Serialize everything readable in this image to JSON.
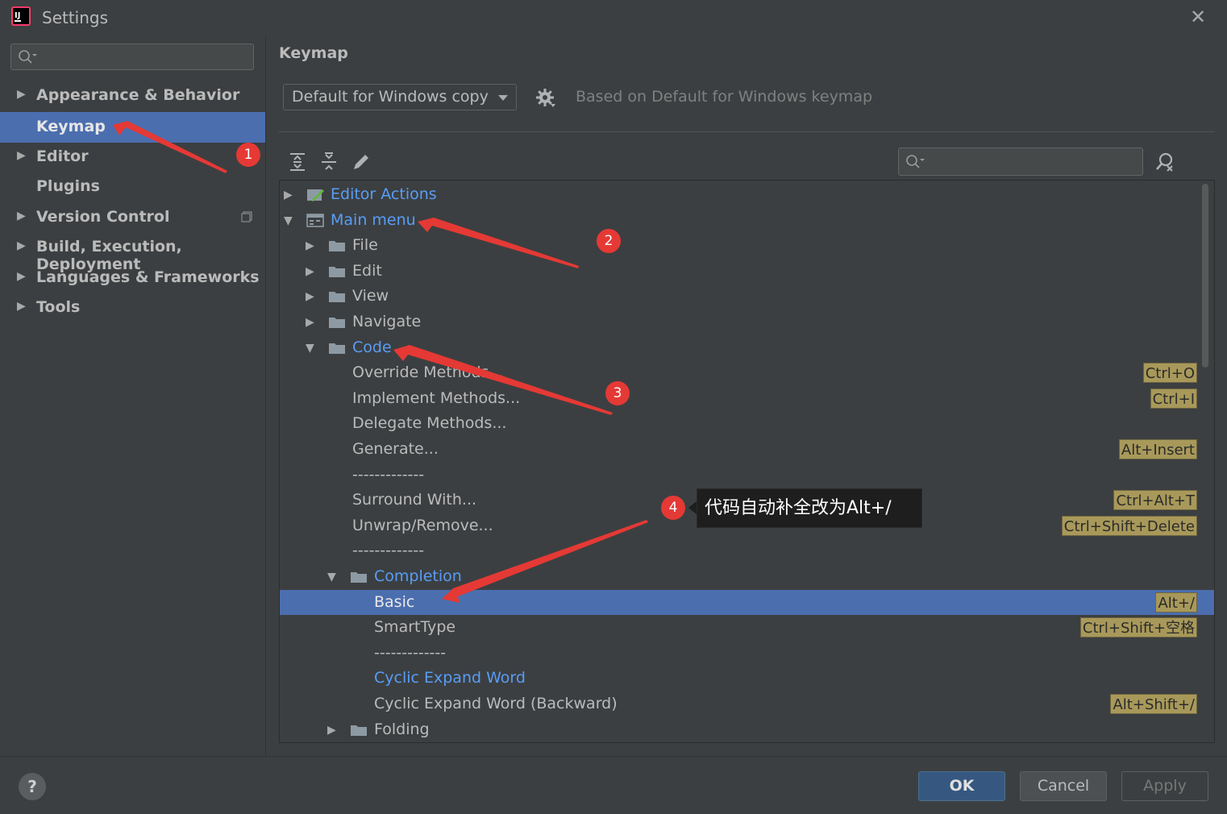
{
  "window": {
    "title": "Settings"
  },
  "sidebar": {
    "search_placeholder": "",
    "items": [
      {
        "label": "Appearance & Behavior",
        "expandable": true,
        "selected": false
      },
      {
        "label": "Keymap",
        "expandable": false,
        "selected": true
      },
      {
        "label": "Editor",
        "expandable": true,
        "selected": false
      },
      {
        "label": "Plugins",
        "expandable": false,
        "selected": false
      },
      {
        "label": "Version Control",
        "expandable": true,
        "selected": false
      },
      {
        "label": "Build, Execution, Deployment",
        "expandable": true,
        "selected": false
      },
      {
        "label": "Languages & Frameworks",
        "expandable": true,
        "selected": false
      },
      {
        "label": "Tools",
        "expandable": true,
        "selected": false
      }
    ]
  },
  "main": {
    "title": "Keymap",
    "keymap_select": "Default for Windows copy",
    "based_on": "Based on Default for Windows keymap",
    "tree": [
      {
        "label": "Editor Actions",
        "indent": 0,
        "arrow": "right",
        "icon": "editor-actions-icon",
        "blue": true,
        "shortcut": ""
      },
      {
        "label": "Main menu",
        "indent": 0,
        "arrow": "down",
        "icon": "main-menu-icon",
        "blue": true,
        "shortcut": ""
      },
      {
        "label": "File",
        "indent": 1,
        "arrow": "right",
        "icon": "folder-icon",
        "blue": false,
        "shortcut": ""
      },
      {
        "label": "Edit",
        "indent": 1,
        "arrow": "right",
        "icon": "folder-icon",
        "blue": false,
        "shortcut": ""
      },
      {
        "label": "View",
        "indent": 1,
        "arrow": "right",
        "icon": "folder-icon",
        "blue": false,
        "shortcut": ""
      },
      {
        "label": "Navigate",
        "indent": 1,
        "arrow": "right",
        "icon": "folder-icon",
        "blue": false,
        "shortcut": ""
      },
      {
        "label": "Code",
        "indent": 1,
        "arrow": "down",
        "icon": "folder-icon",
        "blue": true,
        "shortcut": ""
      },
      {
        "label": "Override Methods...",
        "indent": 2,
        "arrow": "",
        "icon": "",
        "blue": false,
        "shortcut": "Ctrl+O"
      },
      {
        "label": "Implement Methods...",
        "indent": 2,
        "arrow": "",
        "icon": "",
        "blue": false,
        "shortcut": "Ctrl+I"
      },
      {
        "label": "Delegate Methods...",
        "indent": 2,
        "arrow": "",
        "icon": "",
        "blue": false,
        "shortcut": ""
      },
      {
        "label": "Generate...",
        "indent": 2,
        "arrow": "",
        "icon": "",
        "blue": false,
        "shortcut": "Alt+Insert"
      },
      {
        "label": "-------------",
        "indent": 2,
        "arrow": "",
        "icon": "",
        "blue": false,
        "shortcut": ""
      },
      {
        "label": "Surround With...",
        "indent": 2,
        "arrow": "",
        "icon": "",
        "blue": false,
        "shortcut": "Ctrl+Alt+T"
      },
      {
        "label": "Unwrap/Remove...",
        "indent": 2,
        "arrow": "",
        "icon": "",
        "blue": false,
        "shortcut": "Ctrl+Shift+Delete"
      },
      {
        "label": "-------------",
        "indent": 2,
        "arrow": "",
        "icon": "",
        "blue": false,
        "shortcut": ""
      },
      {
        "label": "Completion",
        "indent": 2,
        "arrow": "down",
        "icon": "folder-icon",
        "blue": true,
        "shortcut": ""
      },
      {
        "label": "Basic",
        "indent": 3,
        "arrow": "",
        "icon": "",
        "blue": false,
        "shortcut": "Alt+/",
        "selected": true
      },
      {
        "label": "SmartType",
        "indent": 3,
        "arrow": "",
        "icon": "",
        "blue": false,
        "shortcut": "Ctrl+Shift+空格"
      },
      {
        "label": "-------------",
        "indent": 3,
        "arrow": "",
        "icon": "",
        "blue": false,
        "shortcut": ""
      },
      {
        "label": "Cyclic Expand Word",
        "indent": 3,
        "arrow": "",
        "icon": "",
        "blue": true,
        "shortcut": ""
      },
      {
        "label": "Cyclic Expand Word (Backward)",
        "indent": 3,
        "arrow": "",
        "icon": "",
        "blue": false,
        "shortcut": "Alt+Shift+/"
      },
      {
        "label": "Folding",
        "indent": 2,
        "arrow": "right",
        "icon": "folder-icon",
        "blue": false,
        "shortcut": ""
      }
    ]
  },
  "annotations": {
    "badges": [
      "1",
      "2",
      "3",
      "4"
    ],
    "tooltip": "代码自动补全改为Alt+/"
  },
  "buttons": {
    "help": "?",
    "ok": "OK",
    "cancel": "Cancel",
    "apply": "Apply"
  },
  "colors": {
    "accent": "#4b6eaf",
    "background": "#3c3f41",
    "link": "#589df6",
    "shortcut_bg": "#a8995a",
    "annotation": "#e53935"
  }
}
